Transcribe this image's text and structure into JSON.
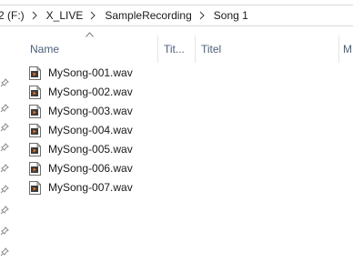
{
  "breadcrumb": {
    "items": [
      "2 (F:)",
      "X_LIVE",
      "SampleRecording",
      "Song 1"
    ]
  },
  "columns": {
    "sort_icon": "chevron-up-icon",
    "headers": [
      "Name",
      "Tit...",
      "Titel",
      "M"
    ]
  },
  "files": [
    {
      "name": "MySong-001.wav",
      "icon": "wav-file-icon"
    },
    {
      "name": "MySong-002.wav",
      "icon": "wav-file-icon"
    },
    {
      "name": "MySong-003.wav",
      "icon": "wav-file-icon"
    },
    {
      "name": "MySong-004.wav",
      "icon": "wav-file-icon"
    },
    {
      "name": "MySong-005.wav",
      "icon": "wav-file-icon"
    },
    {
      "name": "MySong-006.wav",
      "icon": "wav-file-icon"
    },
    {
      "name": "MySong-007.wav",
      "icon": "wav-file-icon"
    }
  ],
  "nav_pins": [
    "pin-icon",
    "pin-icon",
    "pin-icon",
    "pin-icon",
    "pin-icon",
    "pin-icon",
    "pin-icon",
    "pin-icon",
    "pin-icon",
    "pin-icon"
  ],
  "colors": {
    "header_text": "#4c607a",
    "file_icon_accent": "#c0392b",
    "border": "#d9d9d9"
  }
}
